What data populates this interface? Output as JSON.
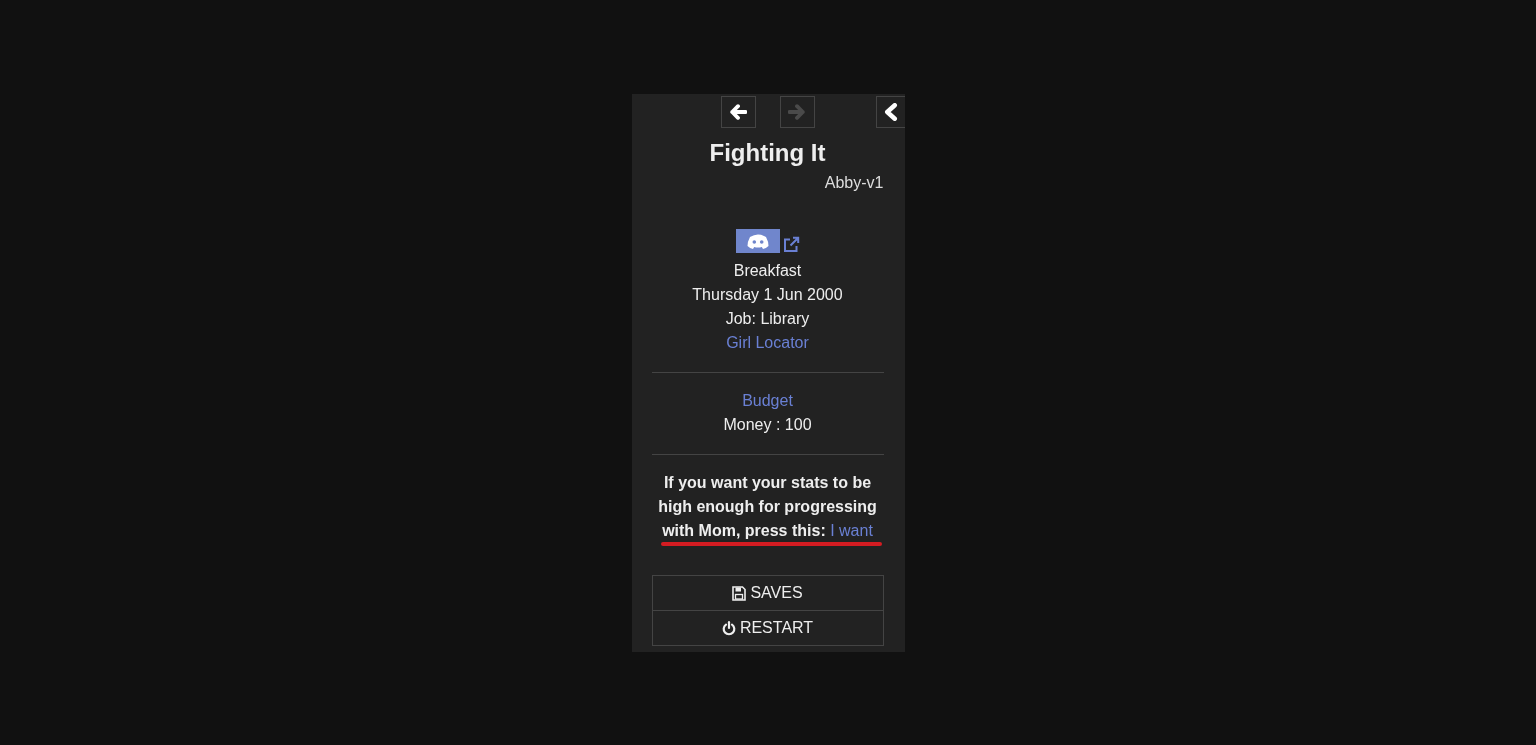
{
  "history": [
    {
      "kind": "back",
      "disabled": false
    },
    {
      "kind": "forward",
      "disabled": true
    }
  ],
  "story": {
    "title": "Fighting It",
    "subtitle": "Abby-v1"
  },
  "caption": [
    {
      "kind": "text",
      "text": "Breakfast"
    },
    {
      "kind": "text",
      "text": "Thursday 1 Jun 2000"
    },
    {
      "kind": "text",
      "text": "Job: Library"
    },
    {
      "kind": "link",
      "text": "Girl Locator"
    }
  ],
  "budget": [
    {
      "kind": "link",
      "text": "Budget"
    },
    {
      "kind": "text",
      "text": "Money : 100"
    }
  ],
  "notice": {
    "text": "If you want your stats to be high enough for progressing with Mom, press this:",
    "link": "I want"
  },
  "menu": [
    {
      "kind": "saves",
      "label": "SAVES"
    },
    {
      "kind": "restart",
      "label": "RESTART"
    }
  ]
}
